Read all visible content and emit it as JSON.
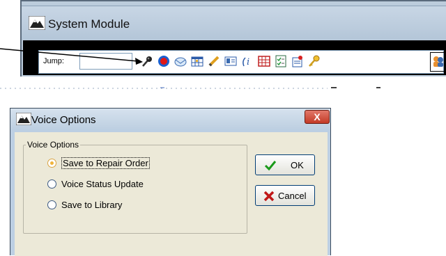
{
  "top_window": {
    "title": "System Module",
    "jump_label": "Jump:",
    "jump_value": "",
    "toolbar_icons": [
      "microphone-icon",
      "record-icon",
      "envelope-icon",
      "grid-icon",
      "pen-icon",
      "contact-card-icon",
      "info-icon",
      "calendar-icon",
      "checklist-icon",
      "note-pin-icon",
      "key-icon",
      "people-icon"
    ]
  },
  "dialog": {
    "title": "Voice Options",
    "close_label": "X",
    "group_label": "Voice Options",
    "options": [
      {
        "label": "Save to Repair Order",
        "selected": true
      },
      {
        "label": "Voice Status Update",
        "selected": false
      },
      {
        "label": "Save to Library",
        "selected": false
      }
    ],
    "ok_label": "OK",
    "cancel_label": "Cancel"
  },
  "colors": {
    "titlebar": "#bccfe3",
    "dialog_body": "#ece9d8",
    "close_button": "#c33a26",
    "radio_selected": "#f0b43c"
  }
}
